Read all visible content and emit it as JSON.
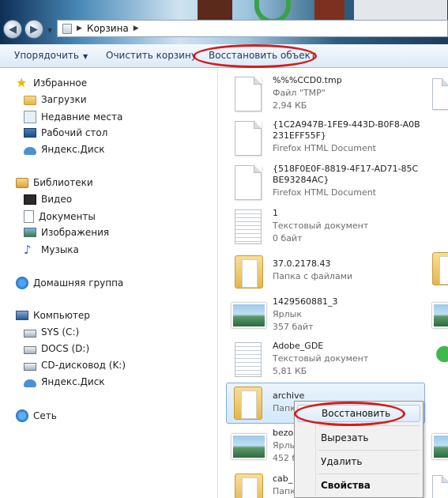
{
  "address": {
    "crumbs": [
      "Корзина"
    ]
  },
  "toolbar": {
    "organize": "Упорядочить",
    "empty": "Очистить корзину",
    "restore_all": "Восстановить объект"
  },
  "nav": {
    "favorites": "Избранное",
    "downloads": "Загрузки",
    "recent": "Недавние места",
    "desktop": "Рабочий стол",
    "yadisk1": "Яндекс.Диск",
    "libraries": "Библиотеки",
    "video": "Видео",
    "documents": "Документы",
    "images": "Изображения",
    "music": "Музыка",
    "homegroup": "Домашняя группа",
    "computer": "Компьютер",
    "drive_c": "SYS (C:)",
    "drive_d": "DOCS (D:)",
    "drive_k": "CD-дисковод (K:)",
    "yadisk2": "Яндекс.Диск",
    "network": "Сеть"
  },
  "files": [
    {
      "name": "%%%CCD0.tmp",
      "type": "Файл \"TMP\"",
      "size": "2,94 КБ",
      "icon": "doc"
    },
    {
      "name": "{1C2A947B-1FE9-443D-B0F8-A0B231EFF55F}",
      "type": "Firefox HTML Document",
      "size": "",
      "icon": "doc"
    },
    {
      "name": "{518F0E0F-8819-4F17-AD71-85CBE93284AC}",
      "type": "Firefox HTML Document",
      "size": "",
      "icon": "doc"
    },
    {
      "name": "1",
      "type": "Текстовый документ",
      "size": "0 байт",
      "icon": "txt"
    },
    {
      "name": "37.0.2178.43",
      "type": "Папка с файлами",
      "size": "",
      "icon": "folder"
    },
    {
      "name": "1429560881_3",
      "type": "Ярлык",
      "size": "357 байт",
      "icon": "link"
    },
    {
      "name": "Adobe_GDE",
      "type": "Текстовый документ",
      "size": "5,81 КБ",
      "icon": "txt"
    },
    {
      "name": "archive",
      "type": "Папка",
      "size": "",
      "icon": "folder"
    },
    {
      "name": "bezo",
      "type": "Ярлы",
      "size": "452 б",
      "icon": "link"
    },
    {
      "name": "cab_",
      "type": "Папк",
      "size": "",
      "icon": "folder"
    }
  ],
  "context_menu": {
    "restore": "Восстановить",
    "cut": "Вырезать",
    "delete": "Удалить",
    "properties": "Свойства"
  },
  "colors": {
    "highlight_oval": "#d41c1c",
    "selection": "#d3e8fb"
  }
}
